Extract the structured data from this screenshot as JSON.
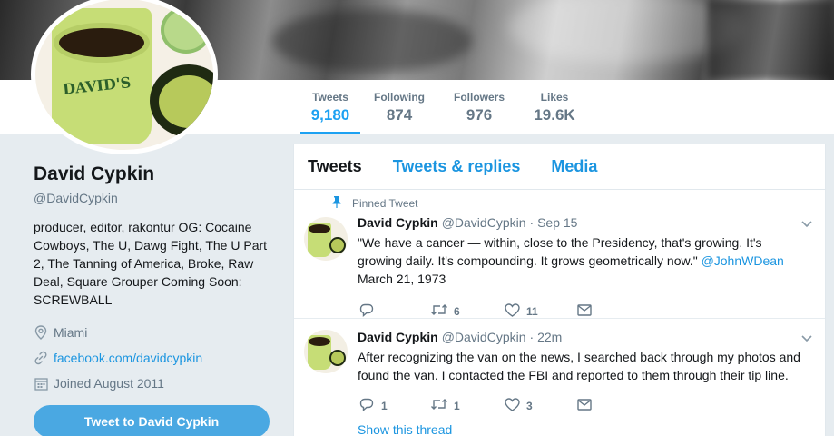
{
  "nav": {
    "stats": [
      {
        "label": "Tweets",
        "value": "9,180",
        "active": true
      },
      {
        "label": "Following",
        "value": "874",
        "active": false
      },
      {
        "label": "Followers",
        "value": "976",
        "active": false
      },
      {
        "label": "Likes",
        "value": "19.6K",
        "active": false
      }
    ]
  },
  "avatar": {
    "cup_text": "DAVID'S"
  },
  "profile": {
    "name": "David Cypkin",
    "handle": "@DavidCypkin",
    "bio": "producer, editor, rakontur OG: Cocaine Cowboys, The U, Dawg Fight, The U Part 2, The Tanning of America, Broke, Raw Deal, Square Grouper Coming Soon: SCREWBALL",
    "location": "Miami",
    "website": "facebook.com/davidcypkin",
    "joined": "Joined August 2011",
    "tweet_to_label": "Tweet to David Cypkin"
  },
  "timeline": {
    "tabs": [
      {
        "label": "Tweets",
        "active": true
      },
      {
        "label": "Tweets & replies",
        "active": false
      },
      {
        "label": "Media",
        "active": false
      }
    ],
    "tweets": [
      {
        "pinned_label": "Pinned Tweet",
        "name": "David Cypkin",
        "handle": "@DavidCypkin",
        "time": "· Sep 15",
        "text": "\"We have a cancer — within, close to the Presidency, that's growing. It's growing daily. It's compounding. It grows geometrically now.\"",
        "mention": "@JohnWDean",
        "text2": "March 21, 1973",
        "replies": "",
        "retweets": "6",
        "likes": "11"
      },
      {
        "name": "David Cypkin",
        "handle": "@DavidCypkin",
        "time": "· 22m",
        "text": "After recognizing the van on the news, I searched back through my photos and found the van. I contacted the FBI and reported to them through their tip line.",
        "replies": "1",
        "retweets": "1",
        "likes": "3",
        "show_thread": "Show this thread"
      }
    ]
  },
  "icons": {
    "location": "map-pin-icon",
    "link": "link-icon",
    "calendar": "calendar-icon",
    "pin": "pin-icon",
    "reply": "reply-icon",
    "retweet": "retweet-icon",
    "like": "heart-icon",
    "dm": "envelope-icon",
    "caret": "chevron-down-icon"
  },
  "colors": {
    "accent": "#1da1f2",
    "link": "#1b95e0",
    "button": "#4aa8e2"
  }
}
